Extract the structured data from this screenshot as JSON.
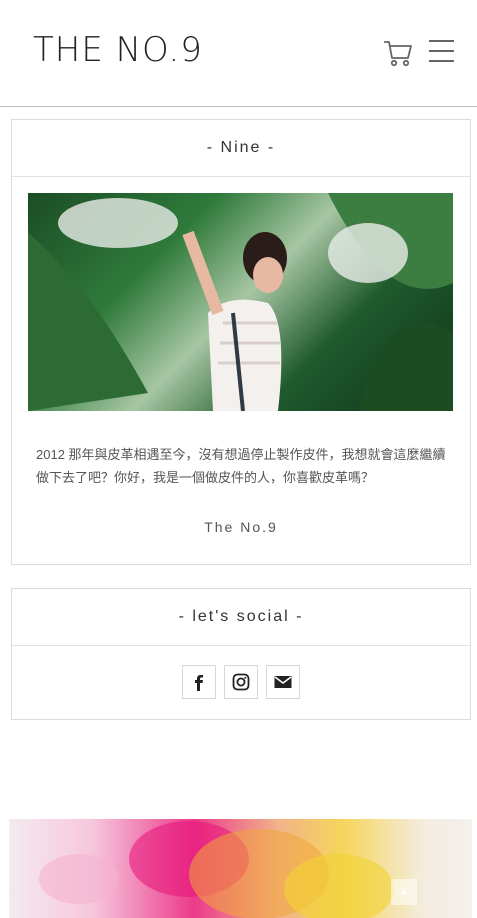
{
  "header": {
    "logo": "THE NO.9",
    "cart_icon": "cart-icon",
    "menu_icon": "hamburger-menu-icon"
  },
  "about": {
    "title": "- Nine -",
    "bio": "2012 那年與皮革相遇至今，沒有想過停止製作皮件，我想就會這麼繼續做下去了吧？你好，我是一個做皮件的人，你喜歡皮革嗎？",
    "signature": "The No.9"
  },
  "social": {
    "title": "- let's social -",
    "icons": [
      "facebook-icon",
      "instagram-icon",
      "email-icon"
    ]
  },
  "back_to_top": "▲",
  "colors": {
    "border": "#dcdcdc",
    "text": "#333333",
    "header_rule": "#bdbdbd"
  }
}
